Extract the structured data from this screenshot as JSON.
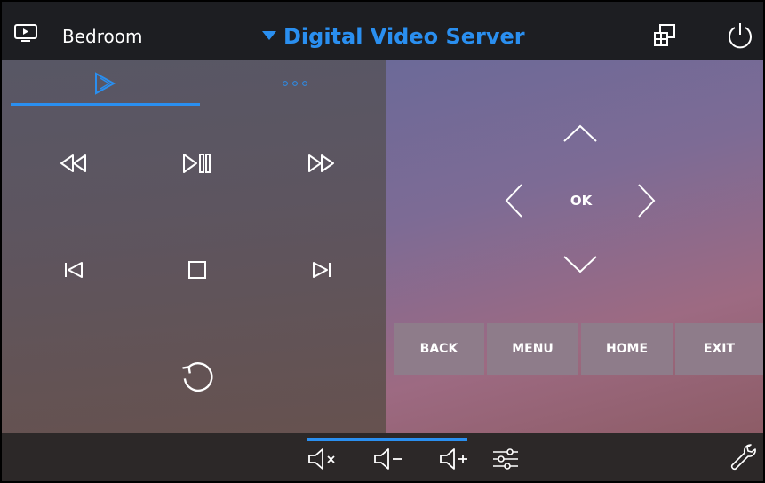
{
  "header": {
    "room_icon": "tv-play-icon",
    "room_name": "Bedroom",
    "source_title": "Digital Video Server",
    "multiview_icon": "windows-icon",
    "power_icon": "power-icon"
  },
  "tabs": [
    {
      "icon": "play-outline-icon",
      "active": true
    },
    {
      "icon": "more-dots-icon",
      "active": false
    }
  ],
  "transport": [
    {
      "name": "rewind",
      "icon": "rewind-icon"
    },
    {
      "name": "play-pause",
      "icon": "play-pause-icon"
    },
    {
      "name": "fast-forward",
      "icon": "fast-forward-icon"
    },
    {
      "name": "previous",
      "icon": "skip-back-icon"
    },
    {
      "name": "stop",
      "icon": "stop-icon"
    },
    {
      "name": "next",
      "icon": "skip-forward-icon"
    },
    {
      "name": "replay",
      "icon": "replay-icon"
    }
  ],
  "nav": {
    "ok_label": "OK"
  },
  "menu_buttons": {
    "back": "BACK",
    "menu": "MENU",
    "home": "HOME",
    "exit": "EXIT"
  },
  "footer": {
    "mute_icon": "volume-mute-icon",
    "vol_down_icon": "volume-down-icon",
    "vol_up_icon": "volume-up-icon",
    "audio_settings_icon": "sliders-icon",
    "settings_icon": "wrench-icon"
  },
  "colors": {
    "accent": "#2a8ff0",
    "header_bg": "#1d1e22",
    "footer_bg": "#2c2828",
    "menu_button_bg": "#8e7c8a"
  }
}
